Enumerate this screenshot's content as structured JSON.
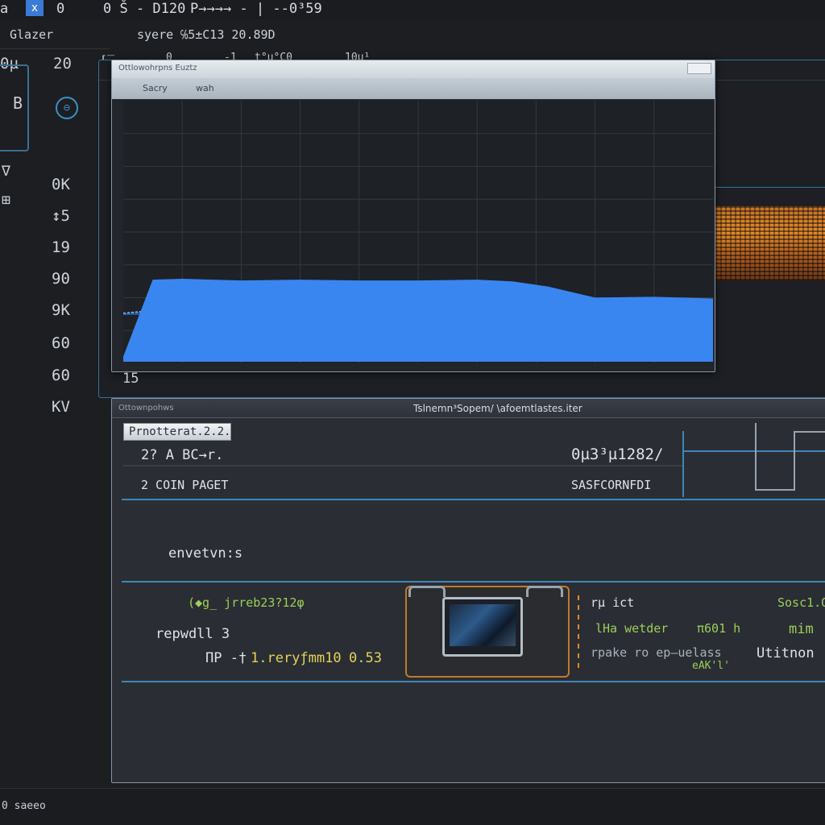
{
  "topbar": {
    "left_text": "a",
    "app_icon": "x",
    "app_icon_name": "tool-icon",
    "items": [
      "0",
      "0 Š - D120",
      "P→→→→ - | --0³59"
    ]
  },
  "header": {
    "left_label": "Glazer",
    "right_label": "syere ℅5±C13  20.89D",
    "row2": [
      "0µ",
      "20",
      "[‾",
      "0",
      "-1",
      "t°µ°C0",
      "10µ¹"
    ]
  },
  "left_rail": {
    "icon_letter": "B",
    "side_icons": [
      "∇",
      "⊞"
    ],
    "circle_icon": "⊖",
    "values": [
      "0K",
      "↕5",
      "19",
      "90",
      "9K",
      "60",
      "60",
      "KV"
    ]
  },
  "top_window": {
    "title": "Ottlowohrpns  Euztz",
    "menu": [
      "Sacry",
      "wah"
    ],
    "x_axis_label": "15"
  },
  "bottom_window": {
    "title_left": "Ottownpohws",
    "title_center": "Tslnemn³Sopem/ \\afoemtlastes.iter",
    "active_tab": "Prnotterat.2.2.",
    "row1_left": "2? A  BC→r.",
    "row1_right": "0µ3³µ1282/",
    "row2_left": "2 COIN PAGET",
    "row2_right": "SASFCORNFDI",
    "section_label": "envetvn:s",
    "sub_header": "(◆g_ jrreb23?12φ",
    "field_label": "repwdll 3",
    "field_value_prefix": "ΠP  -†",
    "field_value_text": "1.reryƒmm10",
    "field_value_number": "0.53",
    "right_col": {
      "r1a": "rµ ict",
      "r1b": "Sosc1.Q",
      "r2a": "lHa wetder",
      "r2b": "π601 h",
      "r2c": "mim",
      "r3a": "rpake ro  ep–uelass",
      "r3b": "Utitnon",
      "r4": "eAK'l'"
    }
  },
  "status_bar": {
    "text": "0 saeeo"
  },
  "chart_data": {
    "type": "area",
    "title": "",
    "x": [
      0,
      0.05,
      0.1,
      0.2,
      0.3,
      0.4,
      0.5,
      0.6,
      0.66,
      0.72,
      0.8,
      0.9,
      1.0
    ],
    "series": [
      {
        "values": [
          0.62,
          0.63,
          0.62,
          0.6,
          0.59,
          0.6,
          0.61,
          0.6,
          0.61,
          0.57,
          0.56,
          0.55,
          0.55
        ]
      },
      {
        "values": [
          0.08,
          0.98,
          0.99,
          0.97,
          0.98,
          0.97,
          0.97,
          0.98,
          0.96,
          0.9,
          0.77,
          0.78,
          0.76
        ]
      }
    ],
    "colors": {
      "upper_band": "#2c5a9c",
      "lower_area": "#3a86f0",
      "grid": "#34383f"
    }
  }
}
